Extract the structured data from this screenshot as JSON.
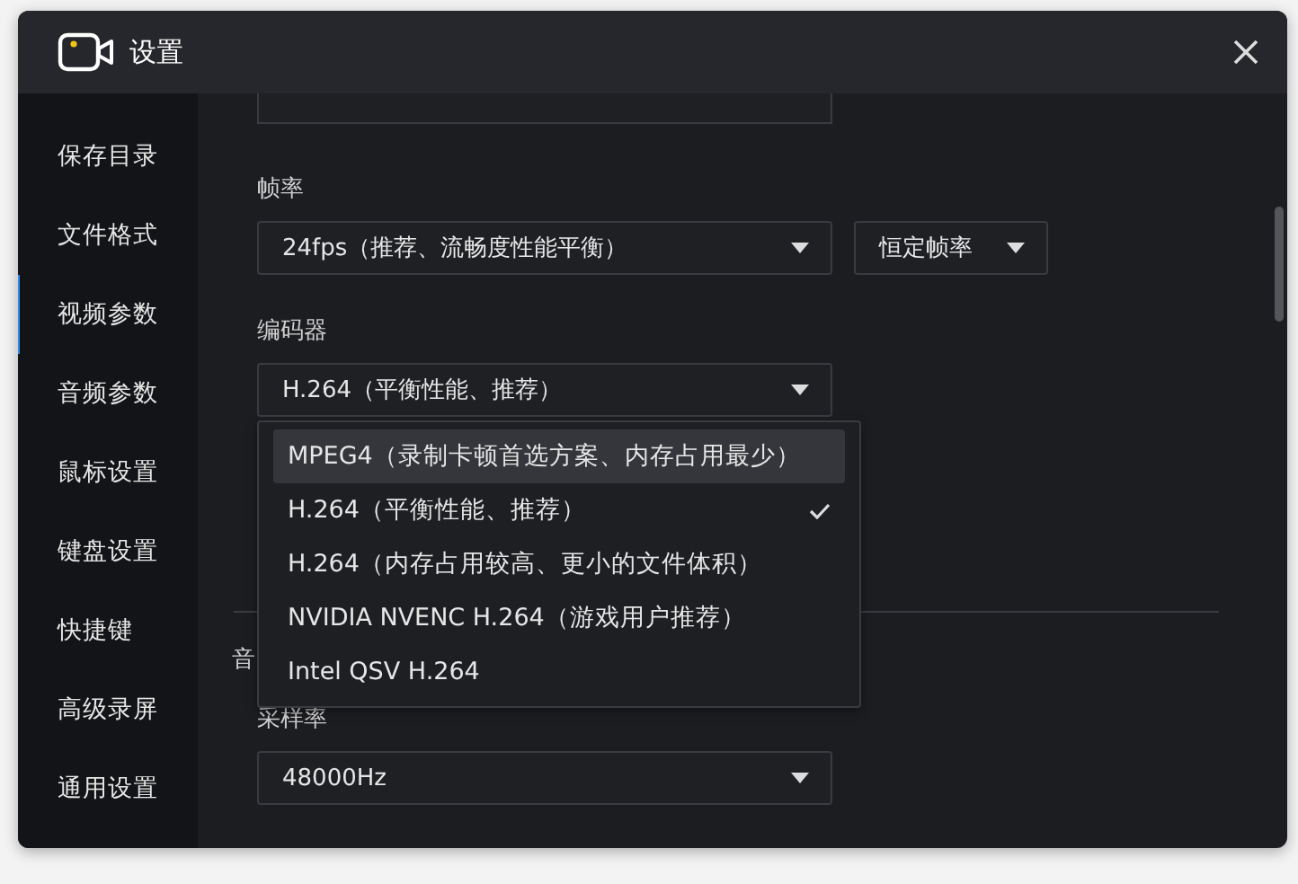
{
  "window": {
    "title": "设置"
  },
  "sidebar": {
    "items": [
      {
        "label": "保存目录",
        "selected": false
      },
      {
        "label": "文件格式",
        "selected": false
      },
      {
        "label": "视频参数",
        "selected": true
      },
      {
        "label": "音频参数",
        "selected": false
      },
      {
        "label": "鼠标设置",
        "selected": false
      },
      {
        "label": "键盘设置",
        "selected": false
      },
      {
        "label": "快捷键",
        "selected": false
      },
      {
        "label": "高级录屏",
        "selected": false
      },
      {
        "label": "通用设置",
        "selected": false
      }
    ]
  },
  "frame_rate": {
    "label": "帧率",
    "value": "24fps（推荐、流畅度性能平衡）",
    "mode": "恒定帧率"
  },
  "encoder": {
    "label": "编码器",
    "value": "H.264（平衡性能、推荐）",
    "expanded": true,
    "options": [
      {
        "label": "MPEG4（录制卡顿首选方案、内存占用最少）",
        "selected": false,
        "hovered": true
      },
      {
        "label": "H.264（平衡性能、推荐）",
        "selected": true,
        "hovered": false
      },
      {
        "label": "H.264（内存占用较高、更小的文件体积）",
        "selected": false,
        "hovered": false
      },
      {
        "label": "NVIDIA NVENC H.264（游戏用户推荐）",
        "selected": false,
        "hovered": false
      },
      {
        "label": "Intel QSV H.264",
        "selected": false,
        "hovered": false
      }
    ]
  },
  "audio_section": {
    "label": "音"
  },
  "sample_rate": {
    "label": "采样率",
    "value": "48000Hz"
  }
}
